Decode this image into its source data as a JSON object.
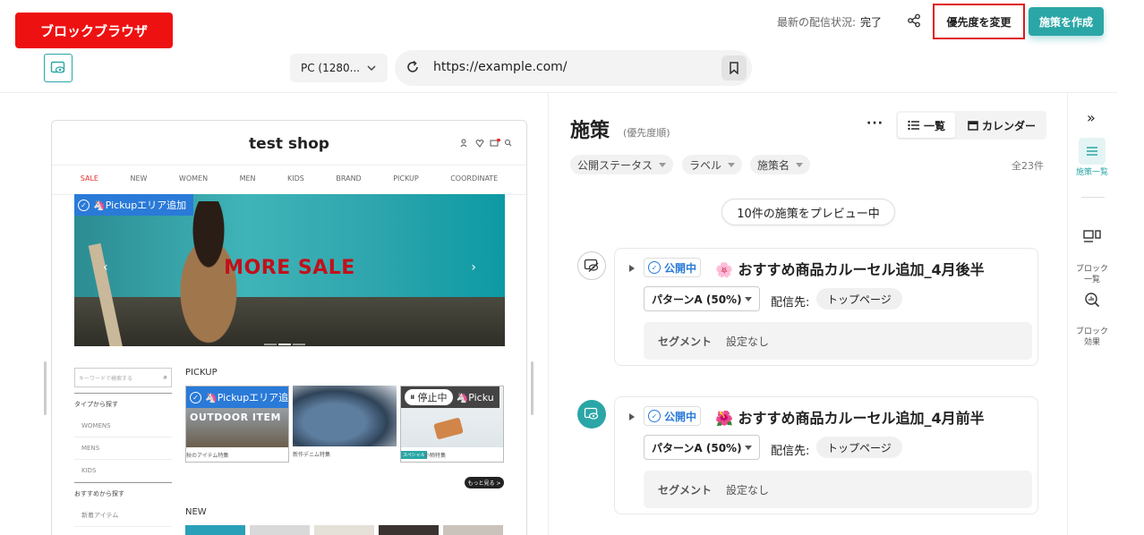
{
  "header": {
    "brand_badge": "ブロックブラウザ",
    "status_label": "最新の配信状況:",
    "status_value": "完了",
    "priority_button": "優先度を変更",
    "create_button": "施策を作成",
    "accent_color": "#2ba6a6"
  },
  "browser_bar": {
    "device": "PC (1280...",
    "url": "https://example.com/"
  },
  "preview": {
    "shop_title": "test shop",
    "nav": [
      "SALE",
      "NEW",
      "WOMEN",
      "MEN",
      "KIDS",
      "BRAND",
      "PICKUP",
      "COORDINATE"
    ],
    "hero_badge": "🦄Pickupエリア追加",
    "hero_text": "MORE SALE",
    "search_placeholder": "キーワードで検索する",
    "side_menu": [
      {
        "label": "タイプから探す",
        "type": "head"
      },
      {
        "label": "WOMENS",
        "type": "sub"
      },
      {
        "label": "MENS",
        "type": "sub"
      },
      {
        "label": "KIDS",
        "type": "sub"
      },
      {
        "label": "おすすめから探す",
        "type": "head"
      },
      {
        "label": "新着アイテム",
        "type": "sub"
      }
    ],
    "pickup_label": "PICKUP",
    "cards": [
      {
        "badge": "🦄Pickupエリア追",
        "overlay": "OUTDOOR ITEM",
        "caption": "秋のアイテム特集"
      },
      {
        "caption": "新作デニム特集"
      },
      {
        "badge_pause": "停止中",
        "badge_rest": "🦄Picku",
        "tag": "スペシャル",
        "caption": "小物特集"
      }
    ],
    "more_button": "もっと見る >",
    "new_label": "NEW"
  },
  "campaigns_panel": {
    "title": "施策",
    "subtitle": "(優先度順)",
    "view_list": "一覧",
    "view_calendar": "カレンダー",
    "filters": [
      "公開ステータス",
      "ラベル",
      "施策名"
    ],
    "total": "全23件",
    "preview_pill": "10件の施策をプレビュー中",
    "campaigns": [
      {
        "status": "公開中",
        "title": "🌸 おすすめ商品カルーセル追加_4月後半",
        "pattern": "パターンA (50%)",
        "dest_label": "配信先:",
        "dest": "トップページ",
        "segment_label": "セグメント",
        "segment_value": "設定なし"
      },
      {
        "status": "公開中",
        "title": "🌺 おすすめ商品カルーセル追加_4月前半",
        "pattern": "パターンA (50%)",
        "dest_label": "配信先:",
        "dest": "トップページ",
        "segment_label": "セグメント",
        "segment_value": "設定なし"
      }
    ]
  },
  "rail": {
    "items": [
      {
        "label": "施策一覧",
        "icon": "list-icon"
      },
      {
        "label": "ブロック\n一覧",
        "icon": "blocks-icon"
      },
      {
        "label": "ブロック\n効果",
        "icon": "analytics-icon"
      }
    ]
  }
}
